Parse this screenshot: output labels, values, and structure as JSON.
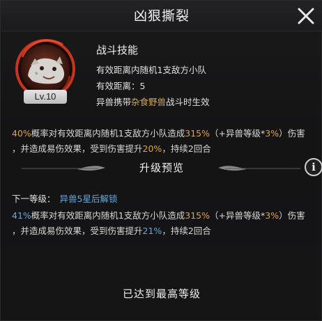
{
  "title": "凶狠撕裂",
  "skill": {
    "level": "Lv.10",
    "type": "战斗技能",
    "target": "有效距离内随机1支敌方小队",
    "range_label": "有效距离：",
    "range_value": "5",
    "condition_prefix": "异兽携带",
    "condition_beast": "杂食野兽",
    "condition_suffix": "战斗时生效"
  },
  "current_desc": {
    "chance": "40%",
    "part1": "概率对有效距离内随机1支敌方小队造成",
    "damage": "315%",
    "part2": "（+异兽等级*",
    "scale": "3%",
    "part3": "）伤害",
    "line2a": "，并造成易伤效果，受到伤害提升",
    "vuln": "20%",
    "line2b": "，持续2回合"
  },
  "upgrade": {
    "title": "升级预览",
    "next_label": "下一等级：",
    "unlock_text": "异兽5星后解锁",
    "chance": "41%",
    "part1": "概率对有效距离内随机1支敌方小队造成",
    "damage": "315%",
    "part2": "（+异兽等级*",
    "scale": "3%",
    "part3": "）伤害",
    "line2a": "，并造成易伤效果，受到伤害提升",
    "vuln": "21%",
    "line2b": "，持续2回合"
  },
  "footer": "已达到最高等级",
  "colors": {
    "highlight": "#e0a24a",
    "next_highlight": "#6aa6d6",
    "portrait_ring": "#c7341f"
  },
  "icons": {
    "close": "close-icon",
    "info": "info-icon",
    "portrait": "wild-beast-portrait"
  }
}
